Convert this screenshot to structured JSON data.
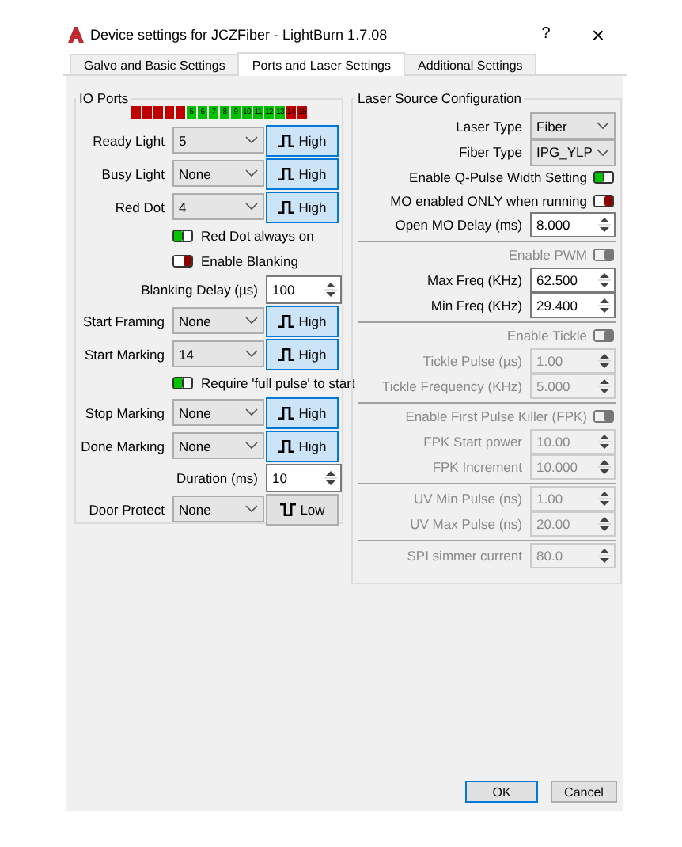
{
  "window": {
    "title": "Device settings for JCZFiber - LightBurn 1.7.08",
    "help": "?",
    "close": "×"
  },
  "tabs": [
    {
      "label": "Galvo and Basic Settings",
      "selected": false
    },
    {
      "label": "Ports and Laser Settings",
      "selected": true
    },
    {
      "label": "Additional Settings",
      "selected": false
    }
  ],
  "io_ports": {
    "title": "IO Ports",
    "ports": [
      {
        "color": "#c00000"
      },
      {
        "color": "#c00000"
      },
      {
        "color": "#c00000"
      },
      {
        "color": "#c00000"
      },
      {
        "color": "#c00000"
      },
      {
        "label": "5",
        "color": "#00c000"
      },
      {
        "label": "6",
        "color": "#00c000"
      },
      {
        "label": "7",
        "color": "#00c000"
      },
      {
        "label": "8",
        "color": "#00c000"
      },
      {
        "label": "9",
        "color": "#00c000"
      },
      {
        "label": "10",
        "color": "#00c000"
      },
      {
        "label": "11",
        "color": "#00c000"
      },
      {
        "label": "12",
        "color": "#00c000"
      },
      {
        "label": "13",
        "color": "#00c000"
      },
      {
        "label": "14",
        "color": "#c00000"
      },
      {
        "label": "15",
        "color": "#c00000"
      }
    ],
    "rows": [
      {
        "kind": "port",
        "label": "Ready Light",
        "value": "5",
        "polarity": "High",
        "high": true
      },
      {
        "kind": "port",
        "label": "Busy Light",
        "value": "None",
        "polarity": "High",
        "high": true
      },
      {
        "kind": "port",
        "label": "Red Dot",
        "value": "4",
        "polarity": "High",
        "high": true
      },
      {
        "kind": "toggle",
        "label": "Red Dot always on",
        "on": true
      },
      {
        "kind": "toggle",
        "label": "Enable Blanking",
        "on": false
      },
      {
        "kind": "spin",
        "label": "Blanking Delay (µs)",
        "value": "100"
      },
      {
        "kind": "port",
        "label": "Start Framing",
        "value": "None",
        "polarity": "High",
        "high": true
      },
      {
        "kind": "port",
        "label": "Start Marking",
        "value": "14",
        "polarity": "High",
        "high": true
      },
      {
        "kind": "toggle",
        "label": "Require 'full pulse' to start",
        "on": true
      },
      {
        "kind": "port",
        "label": "Stop Marking",
        "value": "None",
        "polarity": "High",
        "high": true
      },
      {
        "kind": "port",
        "label": "Done Marking",
        "value": "None",
        "polarity": "High",
        "high": true
      },
      {
        "kind": "spin",
        "label": "Duration (ms)",
        "value": "10"
      },
      {
        "kind": "port",
        "label": "Door Protect",
        "value": "None",
        "polarity": "Low",
        "high": false
      }
    ]
  },
  "laser_source": {
    "title": "Laser Source Configuration",
    "groups": [
      [
        {
          "kind": "combo",
          "label": "Laser Type",
          "value": "Fiber"
        },
        {
          "kind": "combo",
          "label": "Fiber Type",
          "value": "IPG_YLP"
        },
        {
          "kind": "toggle",
          "label": "Enable Q-Pulse Width Setting",
          "on": true,
          "disabled": false
        },
        {
          "kind": "toggle",
          "label": "MO enabled ONLY when running",
          "on": false,
          "disabled": false
        },
        {
          "kind": "spin",
          "label": "Open MO Delay (ms)",
          "value": "8.000",
          "disabled": false
        }
      ],
      [
        {
          "kind": "toggle",
          "label": "Enable PWM",
          "on": false,
          "disabled": true
        },
        {
          "kind": "spin",
          "label": "Max Freq (KHz)",
          "value": "62.500",
          "disabled": false
        },
        {
          "kind": "spin",
          "label": "Min Freq (KHz)",
          "value": "29.400",
          "disabled": false
        }
      ],
      [
        {
          "kind": "toggle",
          "label": "Enable Tickle",
          "on": false,
          "disabled": true
        },
        {
          "kind": "spin",
          "label": "Tickle Pulse (µs)",
          "value": "1.00",
          "disabled": true
        },
        {
          "kind": "spin",
          "label": "Tickle Frequency (KHz)",
          "value": "5.000",
          "disabled": true
        }
      ],
      [
        {
          "kind": "toggle",
          "label": "Enable First Pulse Killer (FPK)",
          "on": false,
          "disabled": true
        },
        {
          "kind": "spin",
          "label": "FPK Start power",
          "value": "10.00",
          "disabled": true
        },
        {
          "kind": "spin",
          "label": "FPK Increment",
          "value": "10.000",
          "disabled": true
        }
      ],
      [
        {
          "kind": "spin",
          "label": "UV Min Pulse (ns)",
          "value": "1.00",
          "disabled": true
        },
        {
          "kind": "spin",
          "label": "UV Max Pulse (ns)",
          "value": "20.00",
          "disabled": true
        }
      ],
      [
        {
          "kind": "spin",
          "label": "SPI simmer current",
          "value": "80.0",
          "disabled": true
        }
      ]
    ]
  },
  "buttons": [
    {
      "label": "OK",
      "default": true
    },
    {
      "label": "Cancel",
      "default": false
    }
  ]
}
